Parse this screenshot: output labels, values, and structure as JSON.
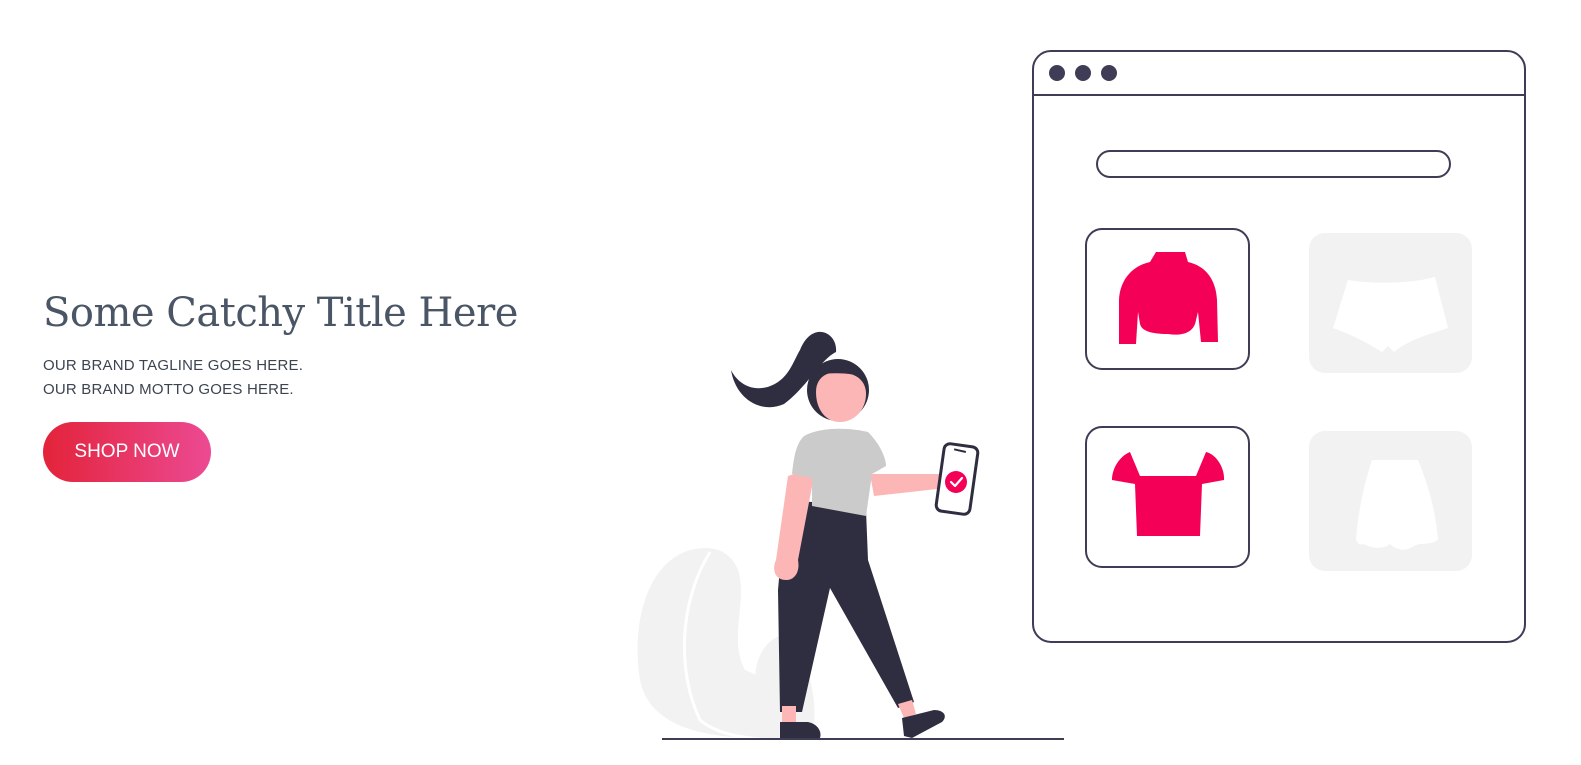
{
  "hero": {
    "title": "Some Catchy Title Here",
    "tagline_line1": "OUR BRAND TAGLINE GOES HERE.",
    "tagline_line2": "OUR BRAND MOTTO GOES HERE.",
    "cta_label": "SHOP NOW"
  },
  "colors": {
    "title": "#4a5565",
    "tagline": "#3c4450",
    "cta_gradient_start": "#e3233a",
    "cta_gradient_end": "#ec4a93",
    "illustration_outline": "#3f3d56",
    "product_accent": "#f50057",
    "placeholder_gray": "#f2f2f2"
  },
  "illustration": {
    "browser_dots": [
      "dot",
      "dot",
      "dot"
    ],
    "products": [
      {
        "name": "sweater-icon",
        "active": true
      },
      {
        "name": "shorts-icon",
        "active": false
      },
      {
        "name": "crop-top-icon",
        "active": true
      },
      {
        "name": "skirt-icon",
        "active": false
      }
    ],
    "phone_status_icon": "check-icon"
  }
}
